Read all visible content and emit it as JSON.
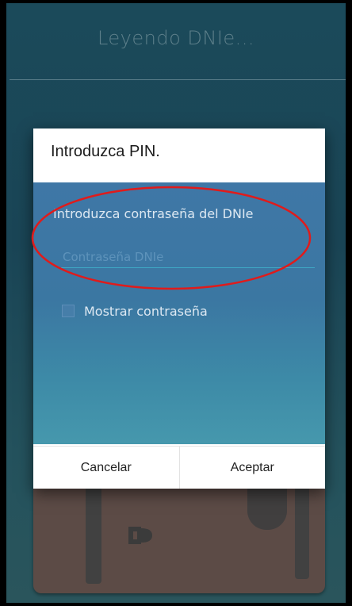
{
  "header": {
    "title": "Leyendo DNIe..."
  },
  "dialog": {
    "title": "Introduzca PIN.",
    "prompt_label": "Introduzca contraseña del DNIe",
    "pin_input": {
      "value": "",
      "placeholder": "Contraseña DNIe"
    },
    "show_password": {
      "label": "Mostrar contraseña",
      "checked": false
    },
    "buttons": {
      "cancel_label": "Cancelar",
      "accept_label": "Aceptar"
    }
  },
  "colors": {
    "dialog_body_top": "#3f77a6",
    "dialog_body_bottom": "#4698ad",
    "input_underline": "#3ea8c5",
    "annotation_ellipse": "#e01b1b"
  },
  "icons": {
    "card_chip": "chip-icon"
  }
}
